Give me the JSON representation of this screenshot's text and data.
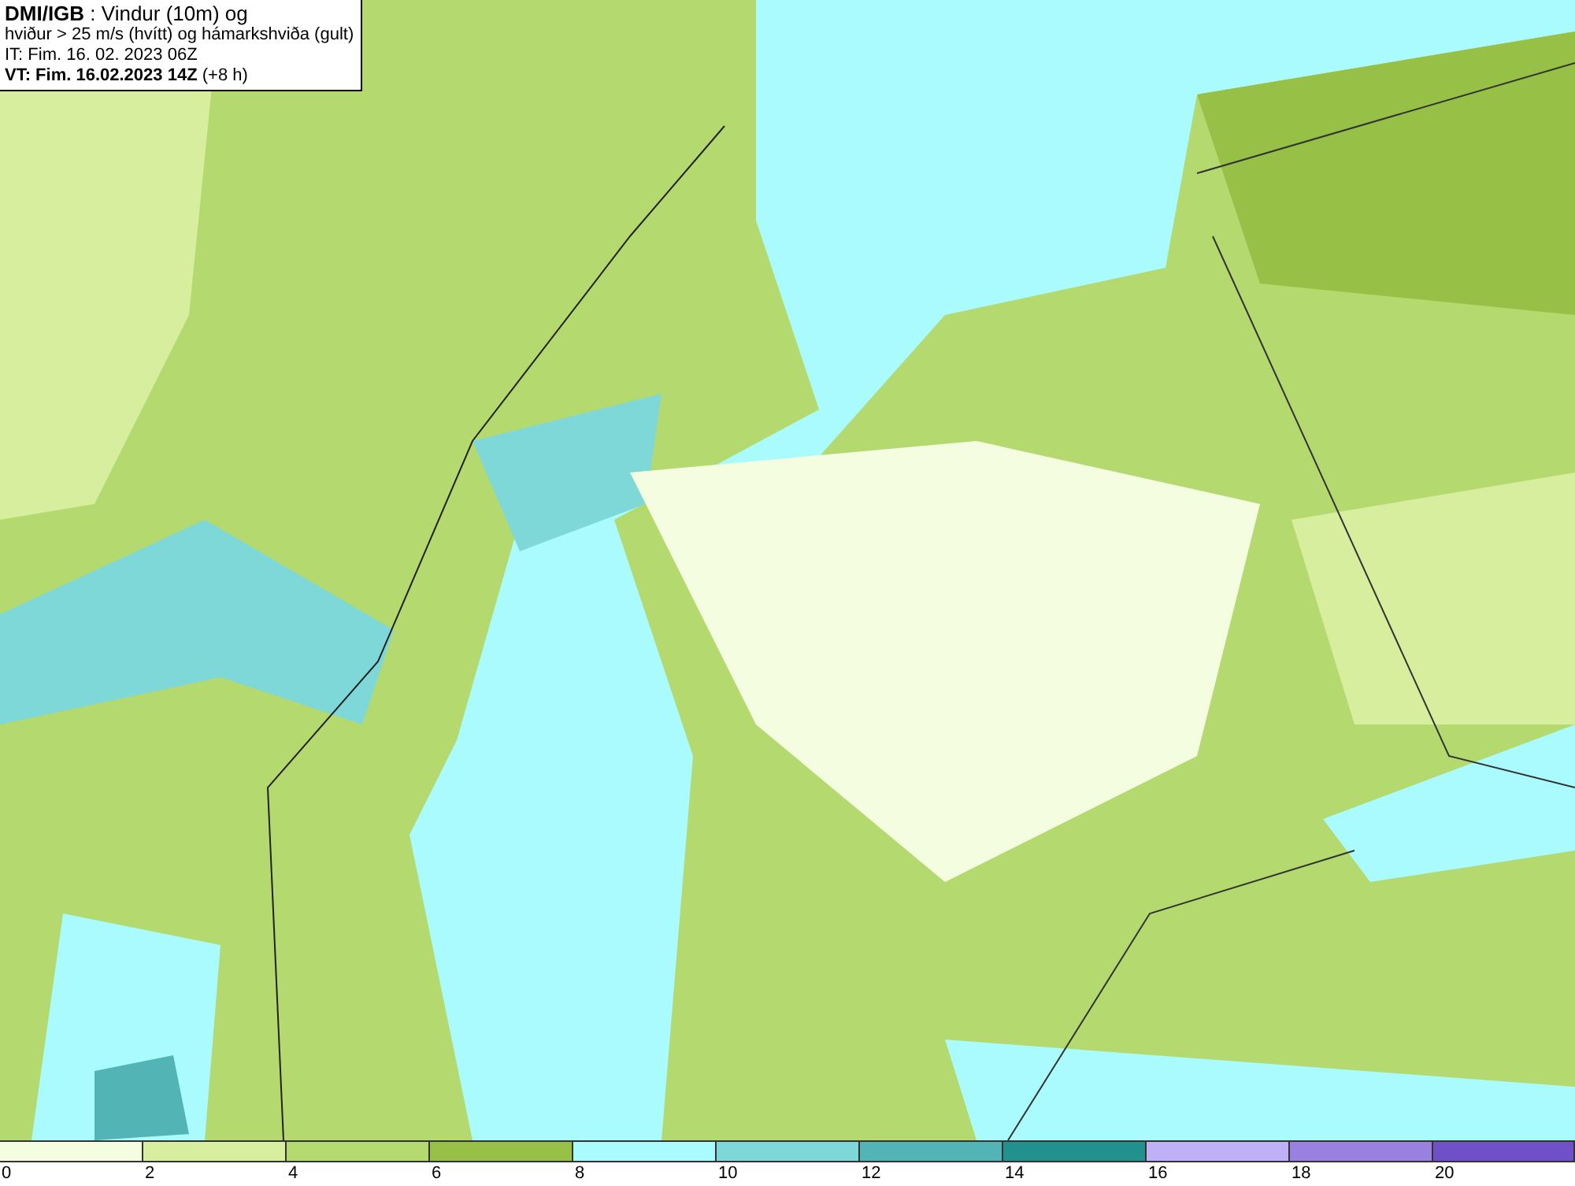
{
  "title_box": {
    "lines": [
      "**DMI/IGB** : Vindur (10m) og",
      "hviður > 25 m/s (hvítt) og hámarkshviða (gult)",
      "IT: Fim. 16. 02. 2023 06Z",
      "**VT: Fim. 16.02.2023 14Z** (+8 h)"
    ]
  },
  "legend": {
    "bins": [
      {
        "label": "0",
        "color": "#f5fde0"
      },
      {
        "label": "2",
        "color": "#d6ee9e"
      },
      {
        "label": "4",
        "color": "#b4d96e"
      },
      {
        "label": "6",
        "color": "#97c046"
      },
      {
        "label": "8",
        "color": "#a9fbfd"
      },
      {
        "label": "10",
        "color": "#7fd8d8"
      },
      {
        "label": "12",
        "color": "#52b4b4"
      },
      {
        "label": "14",
        "color": "#23918d"
      },
      {
        "label": "16",
        "color": "#c0b0f5"
      },
      {
        "label": "18",
        "color": "#9a80e0"
      },
      {
        "label": "20",
        "color": "#7050c8"
      }
    ]
  }
}
